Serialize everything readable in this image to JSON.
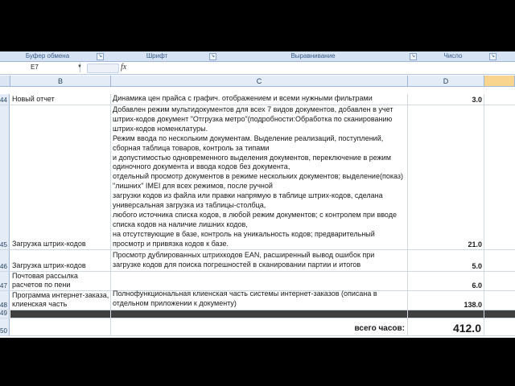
{
  "ribbon": {
    "groups": [
      "Буфер обмена",
      "Шрифт",
      "Выравнивание",
      "Число"
    ]
  },
  "formula_bar": {
    "name_box": "E7",
    "fx_label": "fx",
    "value": ""
  },
  "columns": [
    "B",
    "C",
    "D"
  ],
  "rows": [
    {
      "num": "44",
      "b": "Новый отчет",
      "c": "Динамика цен прайса с графич. отображением и всеми нужными фильтрами",
      "d": "3.0"
    },
    {
      "num": "45",
      "b": "Загрузка штрих-кодов",
      "c": "Добавлен режим мультидокументов для всех 7 видов документов, добавлен в учет\nштрих-кодов документ \"Отгрузка метро\"(подробности:Обработка по сканированию\nштрих-кодов номенклатуры.\nРежим ввода по нескольким документам. Выделение реализаций, поступлений,\nсборная таблица товаров, контроль за типами\nи допустимостью одновременного выделения документов, переключение в режим\nодиночного документа и ввода кодов без документа,\nотдельный просмотр документов в режиме нескольких документов; выделение(показ)\n\"лишних\" IMEI для всех режимов, после ручной\nзагрузки кодов из файла или правки напрямую в таблице штрих-кодов, сделана\nуниверсальная загрузка из таблицы-столбца,\nлюбого источника списка кодов, в любой режим документов; с контролем при вводе\nсписка кодов на наличие лишних кодов,\nна отсутствующие в базе, контроль на уникальность кодов; предварительный\nпросмотр и привязка кодов к базе.",
      "d": "21.0"
    },
    {
      "num": "46",
      "b": "Загрузка штрих-кодов",
      "c": "Просмотр дублированных штрихкодов EAN, расширенный вывод ошибок при\nзагрузке кодов для поиска погрешностей в сканировании партии и итогов",
      "d": "5.0"
    },
    {
      "num": "47",
      "b": "Почтовая рассылка\nрасчетов по пени",
      "c": "",
      "d": "6.0"
    },
    {
      "num": "48",
      "b": "Программа интернет-заказа,\nклиенская часть",
      "c": "Полнофункциональная клиенская часть системы интернет-заказов  (описана в\nотдельном приложении к документу)",
      "d": "138.0"
    },
    {
      "num": "49",
      "b": "",
      "c": "",
      "d": ""
    },
    {
      "num": "50",
      "b": "",
      "c": "всего часов:",
      "d": "412.0"
    }
  ],
  "colors": {
    "row_band": "#3f3f3f",
    "header_bg": "#e4ecf7",
    "selected_header": "#f8d48e"
  }
}
